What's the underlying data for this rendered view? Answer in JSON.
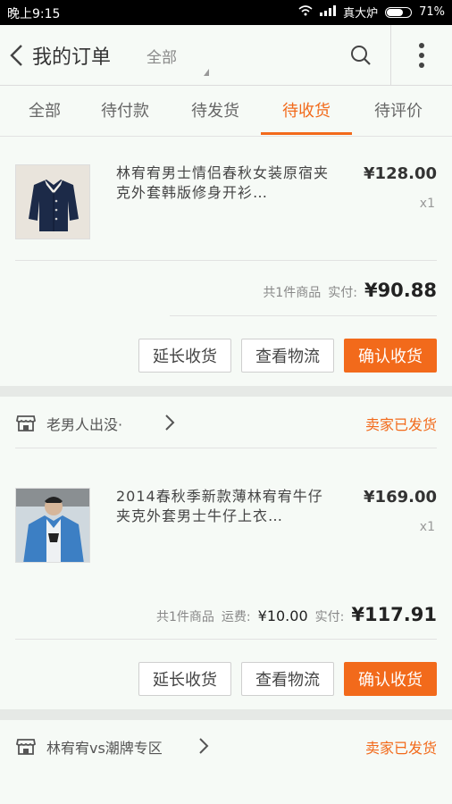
{
  "status_bar": {
    "time": "晚上9:15",
    "carrier": "真大炉",
    "battery": "71%",
    "battery_level": 0.71
  },
  "header": {
    "title": "我的订单",
    "filter": "全部"
  },
  "tabs": [
    {
      "label": "全部"
    },
    {
      "label": "待付款"
    },
    {
      "label": "待发货"
    },
    {
      "label": "待收货"
    },
    {
      "label": "待评价"
    }
  ],
  "orders": [
    {
      "product_title": "林宥宥男士情侣春秋女装原宿夹克外套韩版修身开衫…",
      "price": "¥128.00",
      "qty": "x1",
      "summary_count": "共1件商品",
      "paid_label": "实付:",
      "paid": "¥90.88",
      "buttons": [
        "延长收货",
        "查看物流",
        "确认收货"
      ]
    },
    {
      "shop_name": "老男人出没·",
      "status": "卖家已发货",
      "product_title": "2014春秋季新款薄林宥宥牛仔夹克外套男士牛仔上衣…",
      "price": "¥169.00",
      "qty": "x1",
      "summary_count": "共1件商品",
      "shipping_label": "运费:",
      "shipping": "¥10.00",
      "paid_label": "实付:",
      "paid": "¥117.91",
      "buttons": [
        "延长收货",
        "查看物流",
        "确认收货"
      ]
    },
    {
      "shop_name": "林宥宥vs潮牌专区",
      "status": "卖家已发货"
    }
  ],
  "colors": {
    "accent": "#f26a1b"
  }
}
